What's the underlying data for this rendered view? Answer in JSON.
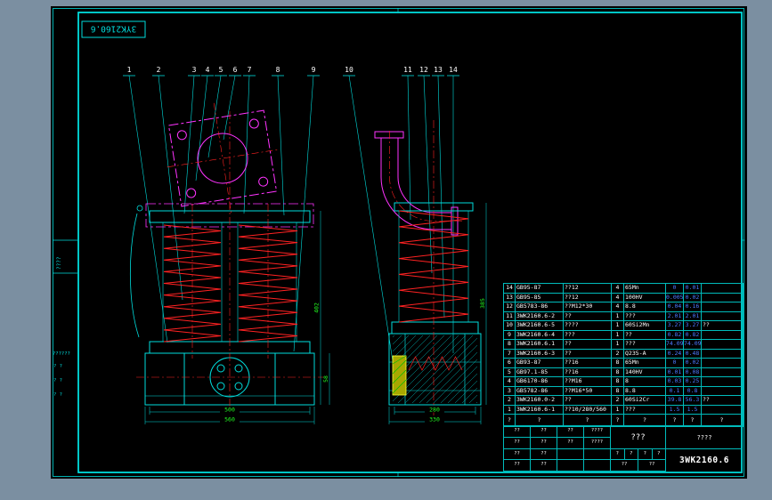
{
  "sheet": {
    "corner_label": "3YK2160.6",
    "margin_texts": {
      "v1": "????",
      "h1": "??????",
      "p1": "? ?",
      "p2": "? ?",
      "p3": "? ?"
    },
    "balloons": [
      "1",
      "2",
      "3",
      "4",
      "5",
      "6",
      "7",
      "8",
      "9",
      "10",
      "11",
      "12",
      "13",
      "14"
    ],
    "dims": {
      "lv_inner": "500",
      "lv_outer": "560",
      "lv_height": "402",
      "lv_base": "58",
      "rv_inner": "280",
      "rv_outer": "330",
      "rv_height": "385"
    },
    "bom": {
      "header": [
        "?",
        "?",
        "?",
        "?",
        "?",
        "?",
        "?",
        "?"
      ],
      "rows": [
        {
          "no": "14",
          "code": "GB95-87",
          "name": "??12",
          "qty": "4",
          "material": "65Mn",
          "unit": "0",
          "total": "0.01",
          "remark": ""
        },
        {
          "no": "13",
          "code": "GB95-85",
          "name": "??12",
          "qty": "4",
          "material": "100HV",
          "unit": "0.005",
          "total": "0.02",
          "remark": ""
        },
        {
          "no": "12",
          "code": "GB5783-86",
          "name": "??M12*30",
          "qty": "4",
          "material": "8.8",
          "unit": "0.04",
          "total": "0.16",
          "remark": ""
        },
        {
          "no": "11",
          "code": "3WK2160.6-2",
          "name": "??",
          "qty": "1",
          "material": "???",
          "unit": "2.01",
          "total": "2.01",
          "remark": ""
        },
        {
          "no": "10",
          "code": "3WK2160.6-5",
          "name": "????",
          "qty": "1",
          "material": "60Si2Mn",
          "unit": "3.27",
          "total": "3.27",
          "remark": "??"
        },
        {
          "no": "9",
          "code": "3WK2160.6-4",
          "name": "???",
          "qty": "1",
          "material": "??",
          "unit": "0.82",
          "total": "0.82",
          "remark": ""
        },
        {
          "no": "8",
          "code": "3WK2160.6.1",
          "name": "??",
          "qty": "1",
          "material": "???",
          "unit": "74.09",
          "total": "74.09",
          "remark": ""
        },
        {
          "no": "7",
          "code": "3WK2160.6-3",
          "name": "??",
          "qty": "2",
          "material": "Q235-A",
          "unit": "0.24",
          "total": "0.48",
          "remark": ""
        },
        {
          "no": "6",
          "code": "GB93-87",
          "name": "??16",
          "qty": "8",
          "material": "65Mn",
          "unit": "0",
          "total": "0.02",
          "remark": ""
        },
        {
          "no": "5",
          "code": "GB97.1-85",
          "name": "??16",
          "qty": "8",
          "material": "140HV",
          "unit": "0.01",
          "total": "0.08",
          "remark": ""
        },
        {
          "no": "4",
          "code": "GB6170-86",
          "name": "??M16",
          "qty": "8",
          "material": "8",
          "unit": "0.03",
          "total": "0.25",
          "remark": ""
        },
        {
          "no": "3",
          "code": "GB5782-86",
          "name": "??M16*50",
          "qty": "8",
          "material": "8.8",
          "unit": "0.1",
          "total": "0.8",
          "remark": ""
        },
        {
          "no": "2",
          "code": "3WK2160.0-2",
          "name": "??",
          "qty": "2",
          "material": "60Si2Cr",
          "unit": "39.8",
          "total": "56.3",
          "remark": "??"
        },
        {
          "no": "1",
          "code": "3WK2160.6-1",
          "name": "??10/280/560",
          "qty": "1",
          "material": "???",
          "unit": "1.5",
          "total": "1.5",
          "remark": ""
        }
      ]
    },
    "title_block": {
      "name": "???",
      "mark": "????",
      "drawing_number": "3WK2160.6",
      "left_cells": [
        "??",
        "??",
        "??",
        "????",
        "??",
        "??",
        "??",
        "????",
        "??",
        "??",
        "",
        "",
        "??",
        "??",
        "",
        ""
      ],
      "mid_row1": [
        "?",
        "?",
        "?",
        "?"
      ],
      "mid_row2": [
        "??",
        "??"
      ]
    },
    "colors": {
      "background": "#7b8fa1",
      "paper": "#000000",
      "line": "#00dcdc",
      "phantom": "#ff33ff",
      "spring": "#ff2222",
      "dim_text": "#22ff22",
      "value_text": "#4d79ff",
      "text": "#ffffff",
      "pad": "#a8a800"
    }
  }
}
